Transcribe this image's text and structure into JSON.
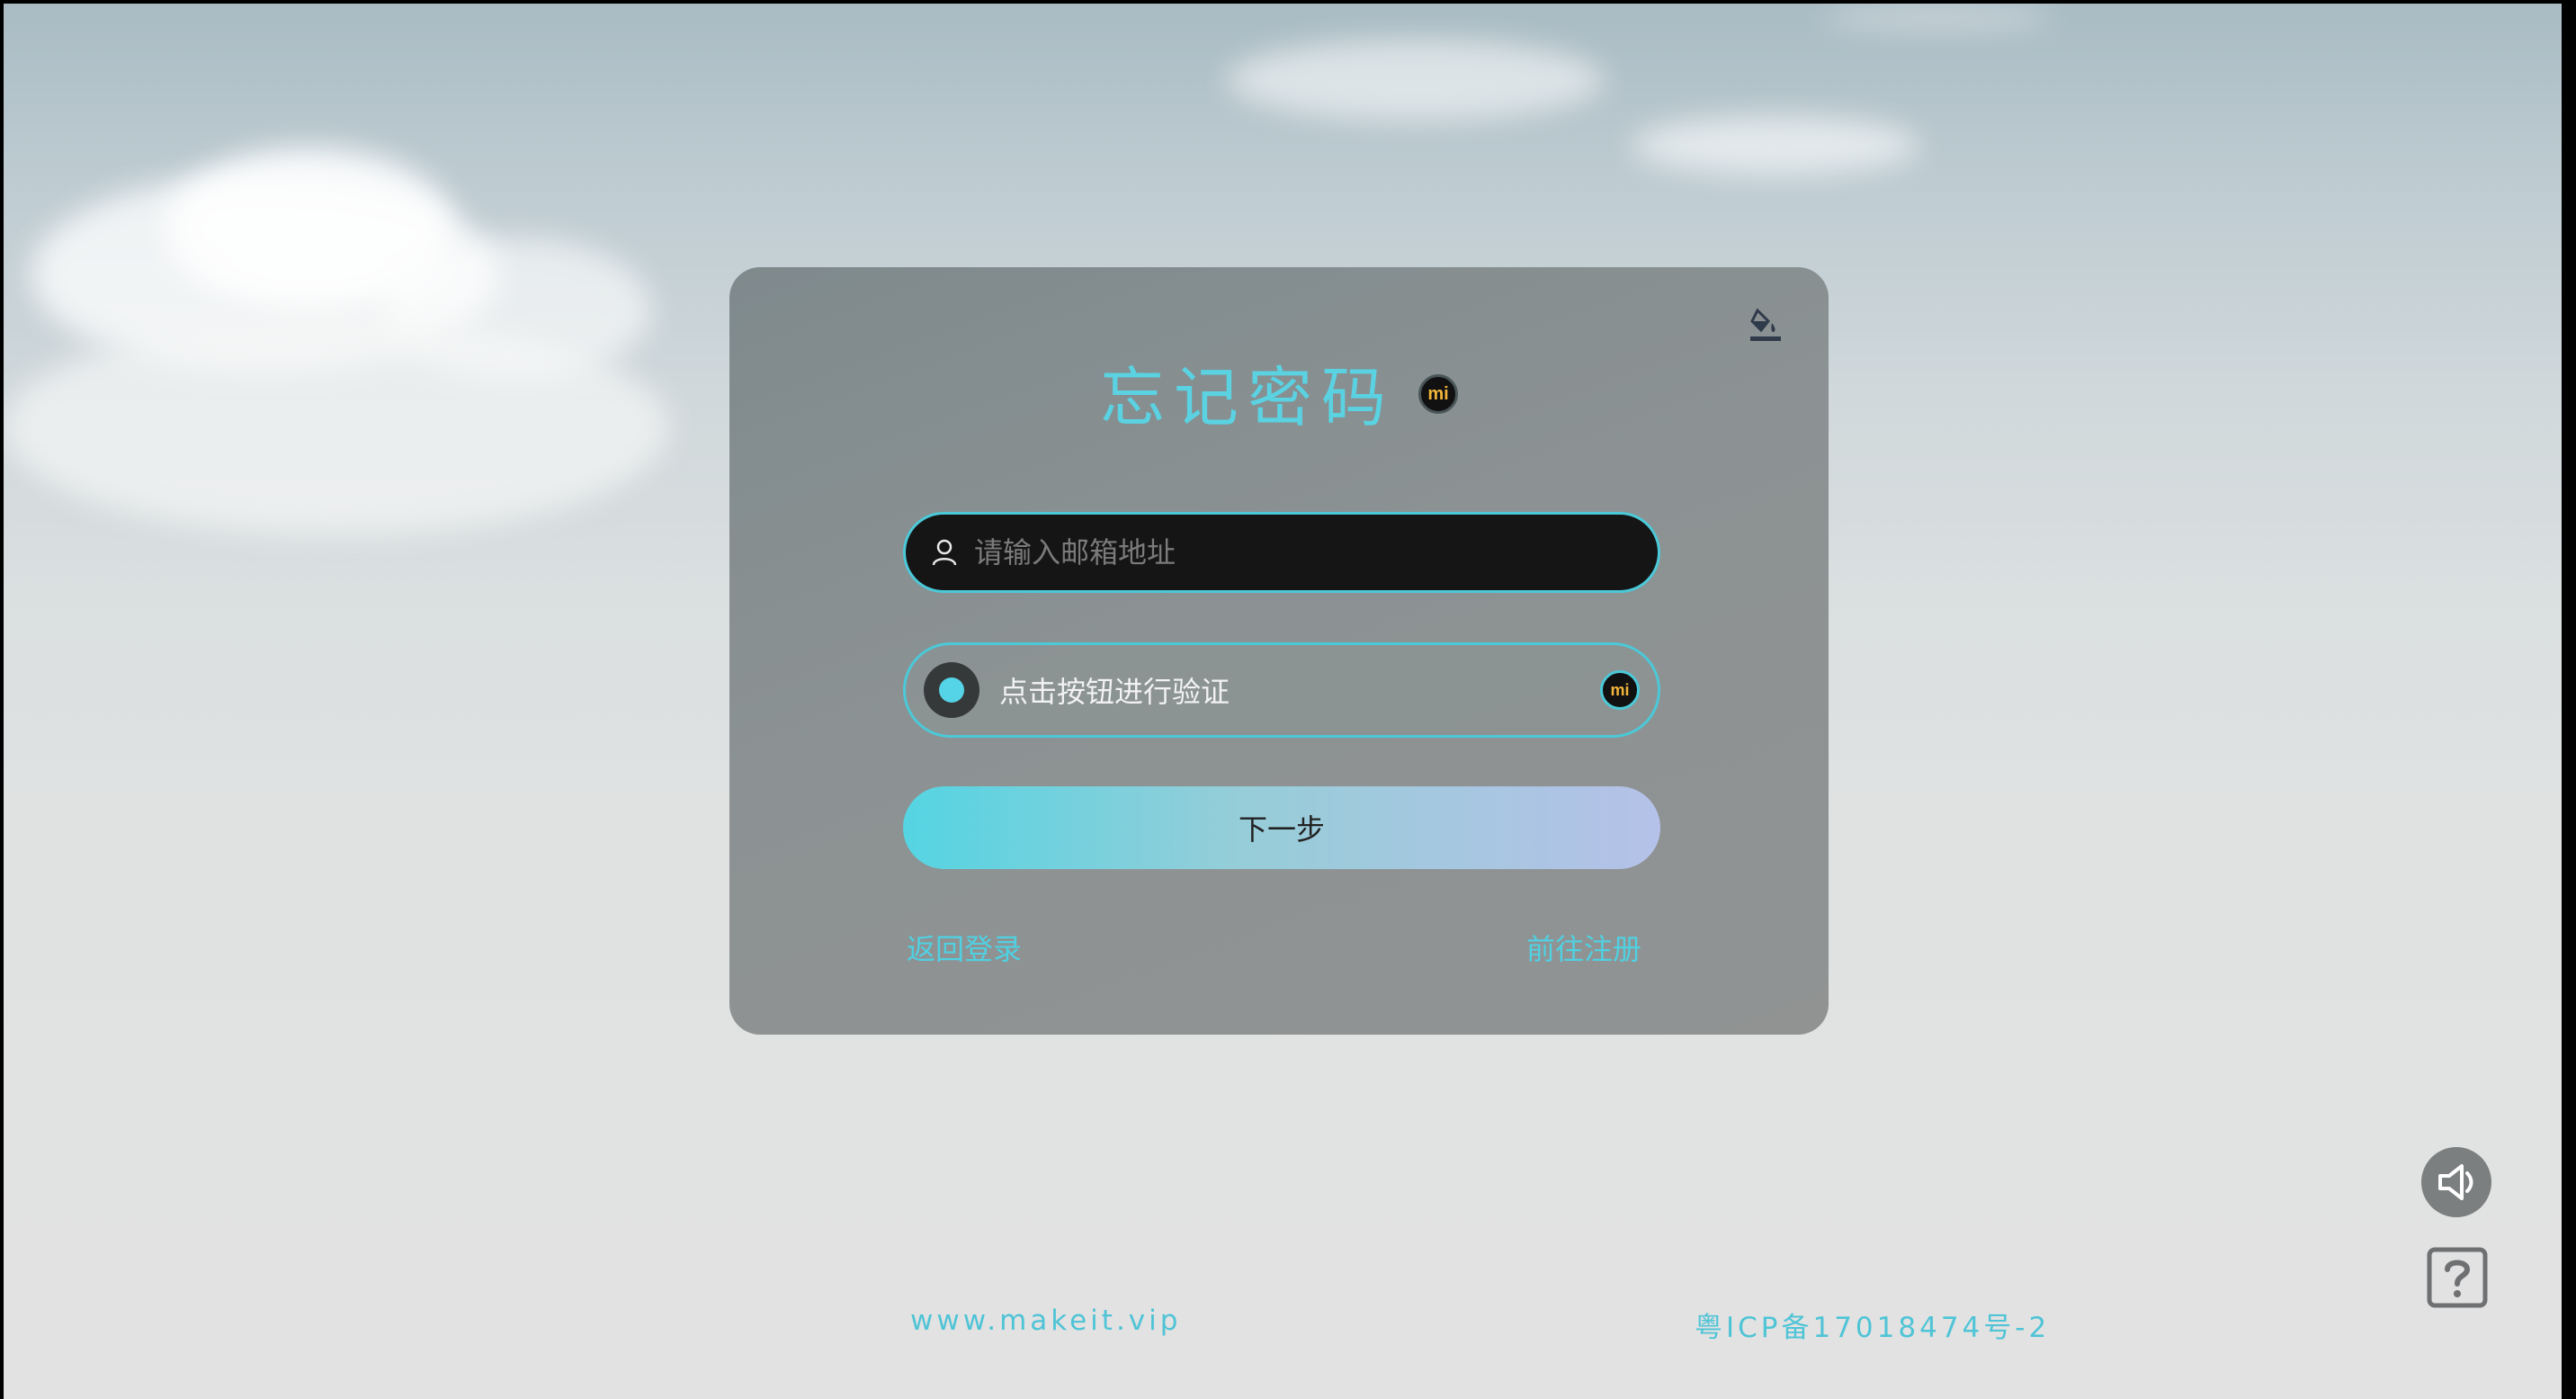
{
  "card": {
    "title": "忘记密码",
    "logo_text": "mi"
  },
  "email": {
    "placeholder": "请输入邮箱地址",
    "value": ""
  },
  "verify": {
    "label": "点击按钮进行验证",
    "logo_text": "mi"
  },
  "actions": {
    "next_label": "下一步",
    "back_login": "返回登录",
    "go_register": "前往注册"
  },
  "footer": {
    "site": "www.makeit.vip",
    "icp": "粤ICP备17018474号-2"
  },
  "icons": {
    "theme": "paint-bucket-icon",
    "user": "user-icon",
    "sound": "speaker-icon",
    "help": "question-icon"
  },
  "colors": {
    "accent": "#4fd1e2",
    "card_bg": "#8a9193",
    "input_bg": "#151515",
    "button_gradient_start": "#55d4e2",
    "button_gradient_end": "#b5c1e8"
  }
}
